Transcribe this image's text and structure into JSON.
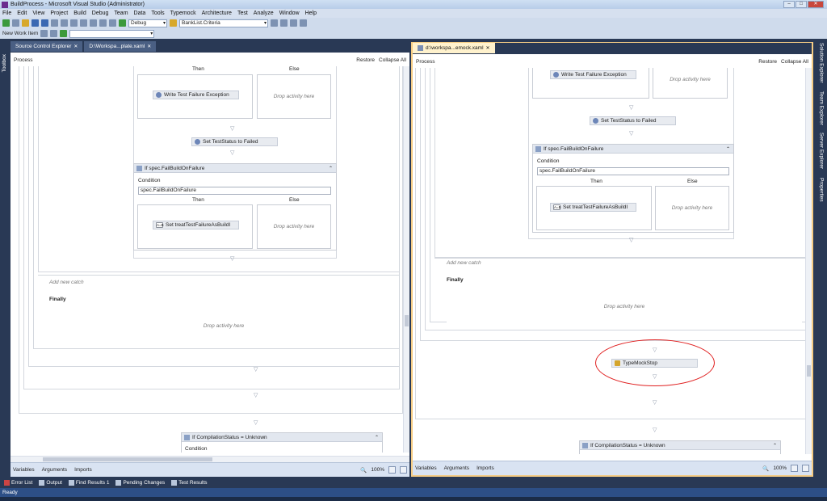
{
  "window": {
    "title": "BuildProcess - Microsoft Visual Studio (Administrator)"
  },
  "menu": [
    "File",
    "Edit",
    "View",
    "Project",
    "Build",
    "Debug",
    "Team",
    "Data",
    "Tools",
    "Typemock",
    "Architecture",
    "Test",
    "Analyze",
    "Window",
    "Help"
  ],
  "toolbar": {
    "config": "Debug",
    "find": "BankList.Criteria",
    "new_work_item": "New Work Item"
  },
  "side": {
    "toolbox": "Toolbox",
    "right_tabs": [
      "Solution Explorer",
      "Team Explorer",
      "Server Explorer",
      "Properties"
    ]
  },
  "left_pane": {
    "tabs": [
      "Source Control Explorer",
      "D:\\Workspa...plate.xaml"
    ],
    "breadcrumb": "Process",
    "restore": "Restore",
    "collapse_all": "Collapse All",
    "then": "Then",
    "else": "Else",
    "write_exc": "Write Test Failure Exception",
    "drop_here": "Drop activity here",
    "set_status": "Set TestStatus to Failed",
    "if_header": "If spec.FailBuildOnFailure",
    "condition": "Condition",
    "condition_value": "spec.FailBuildOnFailure",
    "set_treat": "Set treatTestFailureAsBuildI",
    "add_catch": "Add new catch",
    "finally": "Finally",
    "if_compile": "If CompilationStatus = Unknown",
    "footer": {
      "variables": "Variables",
      "arguments": "Arguments",
      "imports": "Imports",
      "zoom": "100%"
    }
  },
  "right_pane": {
    "tab": "d:\\workspa...emock.xaml",
    "breadcrumb": "Process",
    "restore": "Restore",
    "collapse_all": "Collapse All",
    "then": "Then",
    "else": "Else",
    "write_exc": "Write Test Failure Exception",
    "drop_here": "Drop activity here",
    "set_status": "Set TestStatus to Failed",
    "if_header": "If spec.FailBuildOnFailure",
    "condition": "Condition",
    "condition_value": "spec.FailBuildOnFailure",
    "set_treat": "Set treatTestFailureAsBuildI",
    "add_catch": "Add new catch",
    "finally": "Finally",
    "typemock_stop": "TypeMockStop",
    "if_compile": "If CompilationStatus = Unknown",
    "footer": {
      "variables": "Variables",
      "arguments": "Arguments",
      "imports": "Imports",
      "zoom": "100%"
    }
  },
  "bottom_tabs": [
    "Error List",
    "Output",
    "Find Results 1",
    "Pending Changes",
    "Test Results"
  ],
  "status": "Ready"
}
